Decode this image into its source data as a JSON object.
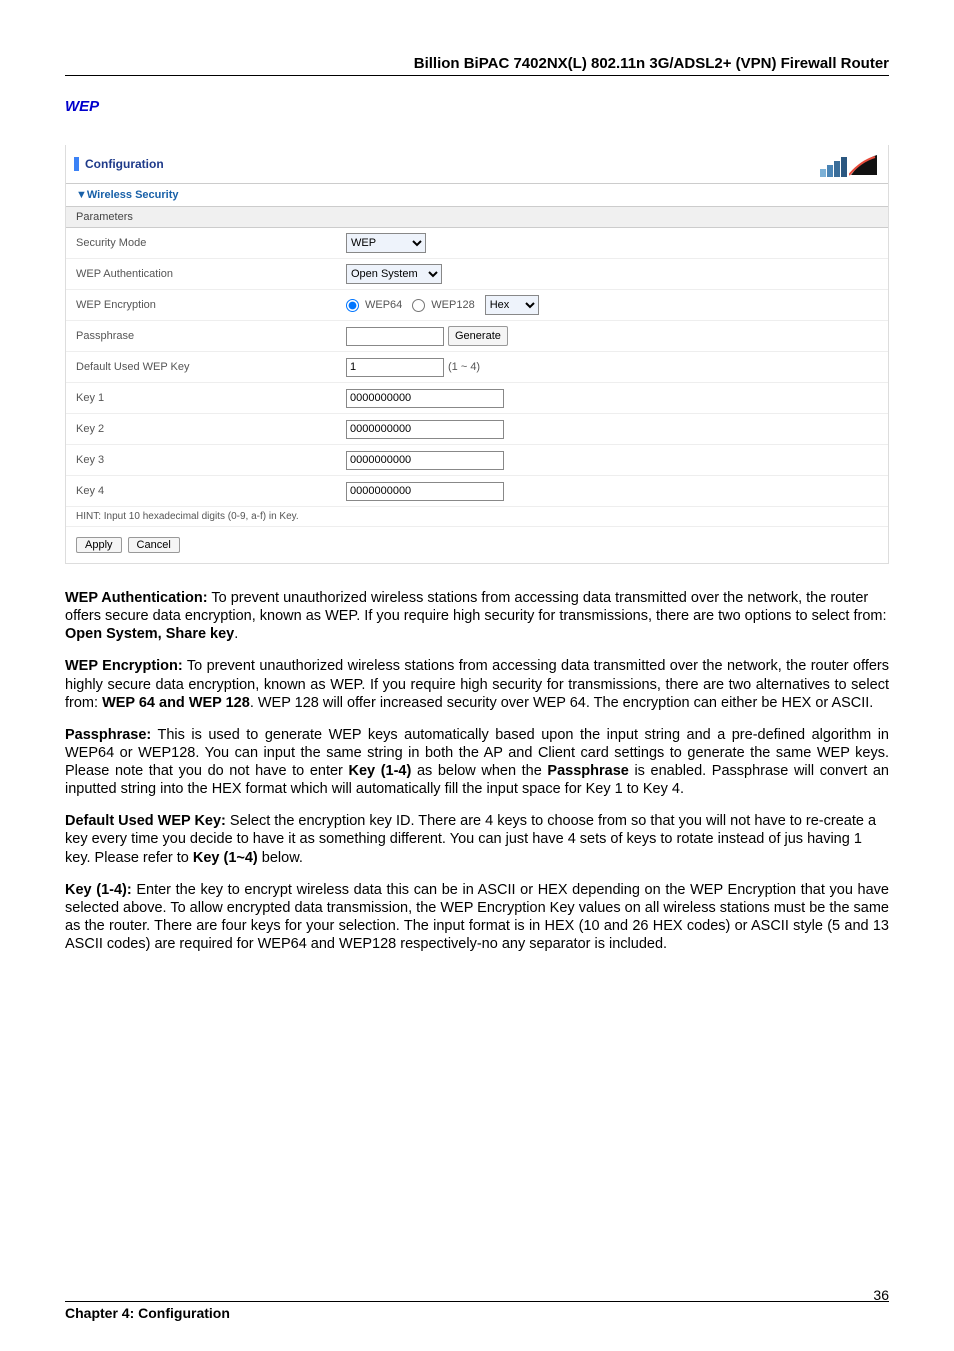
{
  "header": {
    "title": "Billion BiPAC 7402NX(L) 802.11n 3G/ADSL2+ (VPN) Firewall Router"
  },
  "section_title": "WEP",
  "panel": {
    "title": "Configuration",
    "section": "▼Wireless Security",
    "params_label": "Parameters",
    "rows": {
      "security_mode": {
        "label": "Security Mode",
        "value": "WEP"
      },
      "wep_auth": {
        "label": "WEP Authentication",
        "value": "Open System"
      },
      "wep_enc": {
        "label": "WEP Encryption",
        "opt1": "WEP64",
        "opt2": "WEP128",
        "format": "Hex"
      },
      "passphrase": {
        "label": "Passphrase",
        "value": "",
        "button": "Generate"
      },
      "default_key": {
        "label": "Default Used WEP Key",
        "value": "1",
        "hint": "(1 ~ 4)"
      },
      "key1": {
        "label": "Key 1",
        "value": "0000000000"
      },
      "key2": {
        "label": "Key 2",
        "value": "0000000000"
      },
      "key3": {
        "label": "Key 3",
        "value": "0000000000"
      },
      "key4": {
        "label": "Key 4",
        "value": "0000000000"
      }
    },
    "hint": "HINT: Input 10 hexadecimal digits (0-9, a-f) in Key.",
    "apply": "Apply",
    "cancel": "Cancel"
  },
  "body": {
    "p1_b": "WEP Authentication:",
    "p1": " To prevent unauthorized wireless stations from accessing data transmitted over the network, the router offers secure data encryption, known as WEP. If you require high security for transmissions, there are two options to select from: ",
    "p1_b2": "Open System, Share key",
    "p1_end": ".",
    "p2_b": "WEP Encryption:",
    "p2a": " To prevent unauthorized wireless stations from accessing data transmitted over the network, the router offers highly secure data encryption, known as WEP. If you require high security for transmissions, there are two alternatives to select from: ",
    "p2_b2": "WEP 64 and WEP 128",
    "p2b": ". WEP 128 will offer increased security over WEP 64. The encryption can either be HEX or ASCII.",
    "p3_b": "Passphrase:",
    "p3a": " This is used to generate WEP keys automatically based upon the input string and a pre-defined algorithm in WEP64 or WEP128. You can input the same string in both the AP and Client card settings to generate the same WEP keys. Please note that you do not have to enter ",
    "p3_b2": "Key (1-4)",
    "p3b": " as below when the ",
    "p3_b3": "Passphrase",
    "p3c": " is enabled. Passphrase will convert an inputted string into the HEX format which will automatically fill the input space for Key 1 to Key 4.",
    "p4_b": "Default Used WEP Key:",
    "p4a": " Select the encryption key ID. There are 4 keys to choose from so that you will not have to re-create a key every time you decide to have it as something different. You can just have 4 sets of keys to rotate instead of jus having 1 key. Please refer to ",
    "p4_b2": "Key (1~4)",
    "p4b": " below.",
    "p5_b": "Key (1-4):",
    "p5": " Enter the key to encrypt wireless data this can be in ASCII or HEX depending on the WEP Encryption that you have selected above. To allow encrypted data transmission, the WEP Encryption Key values on all wireless stations must be the same as the router. There are four keys for your selection. The input format is in HEX (10 and 26 HEX codes) or ASCII style (5 and 13 ASCII codes) are required for WEP64 and WEP128 respectively-no any separator is included."
  },
  "footer": {
    "chapter": "Chapter 4: Configuration",
    "page": "36"
  }
}
